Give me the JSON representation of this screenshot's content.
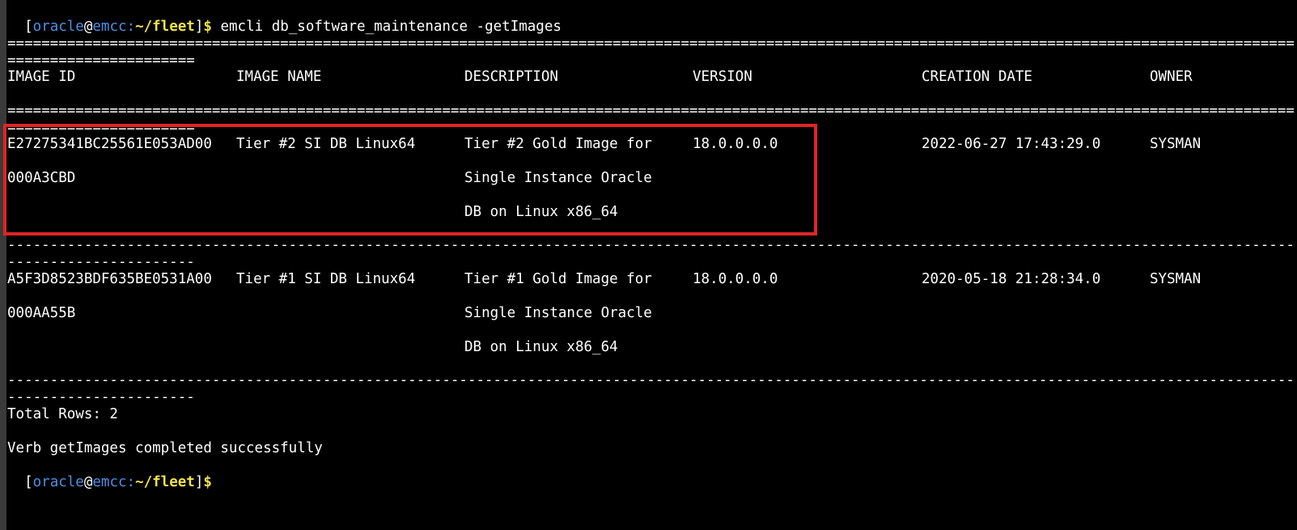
{
  "terminal": {
    "prompt": {
      "open_bracket": "[",
      "user": "oracle",
      "at": "@",
      "host": "emcc:",
      "path": "~/fleet",
      "close_bracket": "]",
      "dollar": "$"
    },
    "command": " emcli db_software_maintenance -getImages",
    "eq_separator": "=============================================================================================================================================================================",
    "dash_separator": "-----------------------------------------------------------------------------------------------------------------------------------------------------------------------------",
    "headers": {
      "image_id": "IMAGE ID",
      "image_name": "IMAGE NAME",
      "description": "DESCRIPTION",
      "version": "VERSION",
      "creation_date": "CREATION DATE",
      "owner": "OWNER"
    },
    "rows": [
      {
        "image_id_line1": "E27275341BC25561E053AD00",
        "image_id_line2": "000A3CBD",
        "image_name": "Tier #2 SI DB Linux64",
        "description_line1": "Tier #2 Gold Image for",
        "description_line2": "Single Instance Oracle",
        "description_line3": "DB on Linux x86_64",
        "version": "18.0.0.0.0",
        "creation_date": "2022-06-27 17:43:29.0",
        "owner": "SYSMAN"
      },
      {
        "image_id_line1": "A5F3D8523BDF635BE0531A00",
        "image_id_line2": "000AA55B",
        "image_name": "Tier #1 SI DB Linux64",
        "description_line1": "Tier #1 Gold Image for",
        "description_line2": "Single Instance Oracle",
        "description_line3": "DB on Linux x86_64",
        "version": "18.0.0.0.0",
        "creation_date": "2020-05-18 21:28:34.0",
        "owner": "SYSMAN"
      }
    ],
    "total_rows": "Total Rows: 2",
    "completion_message": "Verb getImages completed successfully"
  },
  "colors": {
    "background": "#000000",
    "text": "#ffffff",
    "prompt_user_host": "#4e8fe6",
    "prompt_path": "#f0e24a",
    "highlight_border": "#e02424"
  }
}
